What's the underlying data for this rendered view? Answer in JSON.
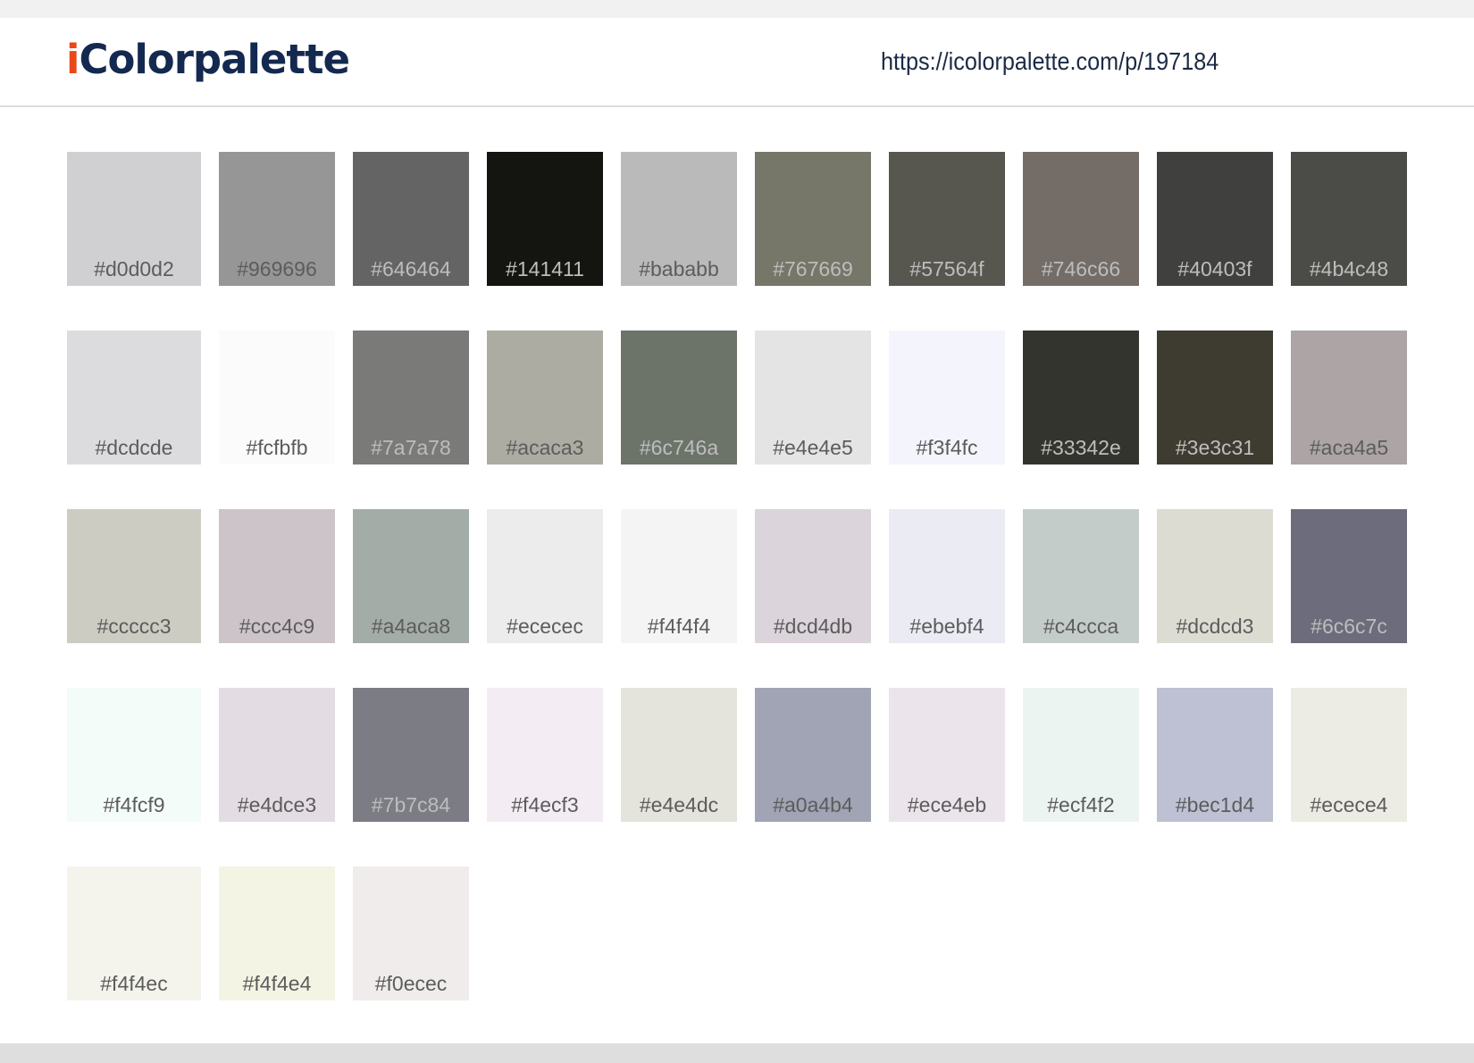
{
  "header": {
    "logo_first_letter": "i",
    "logo_rest": "Colorpalette",
    "url": "https://icolorpalette.com/p/197184"
  },
  "colors": {
    "logo_accent": "#e8481a",
    "logo_main": "#14294f",
    "background": "#ffffff"
  },
  "palette": [
    {
      "hex": "#d0d0d2"
    },
    {
      "hex": "#969696"
    },
    {
      "hex": "#646464"
    },
    {
      "hex": "#141411"
    },
    {
      "hex": "#bababb"
    },
    {
      "hex": "#767669"
    },
    {
      "hex": "#57564f"
    },
    {
      "hex": "#746c66"
    },
    {
      "hex": "#40403f"
    },
    {
      "hex": "#4b4c48"
    },
    {
      "hex": "#dcdcde"
    },
    {
      "hex": "#fcfbfb"
    },
    {
      "hex": "#7a7a78"
    },
    {
      "hex": "#acaca3"
    },
    {
      "hex": "#6c746a"
    },
    {
      "hex": "#e4e4e5"
    },
    {
      "hex": "#f3f4fc"
    },
    {
      "hex": "#33342e"
    },
    {
      "hex": "#3e3c31"
    },
    {
      "hex": "#aca4a5"
    },
    {
      "hex": "#ccccc3"
    },
    {
      "hex": "#ccc4c9"
    },
    {
      "hex": "#a4aca8"
    },
    {
      "hex": "#ececec"
    },
    {
      "hex": "#f4f4f4"
    },
    {
      "hex": "#dcd4db"
    },
    {
      "hex": "#ebebf4"
    },
    {
      "hex": "#c4ccca"
    },
    {
      "hex": "#dcdcd3"
    },
    {
      "hex": "#6c6c7c"
    },
    {
      "hex": "#f4fcf9"
    },
    {
      "hex": "#e4dce3"
    },
    {
      "hex": "#7b7c84"
    },
    {
      "hex": "#f4ecf3"
    },
    {
      "hex": "#e4e4dc"
    },
    {
      "hex": "#a0a4b4"
    },
    {
      "hex": "#ece4eb"
    },
    {
      "hex": "#ecf4f2"
    },
    {
      "hex": "#bec1d4"
    },
    {
      "hex": "#ecece4"
    },
    {
      "hex": "#f4f4ec"
    },
    {
      "hex": "#f4f4e4"
    },
    {
      "hex": "#f0ecec"
    }
  ]
}
